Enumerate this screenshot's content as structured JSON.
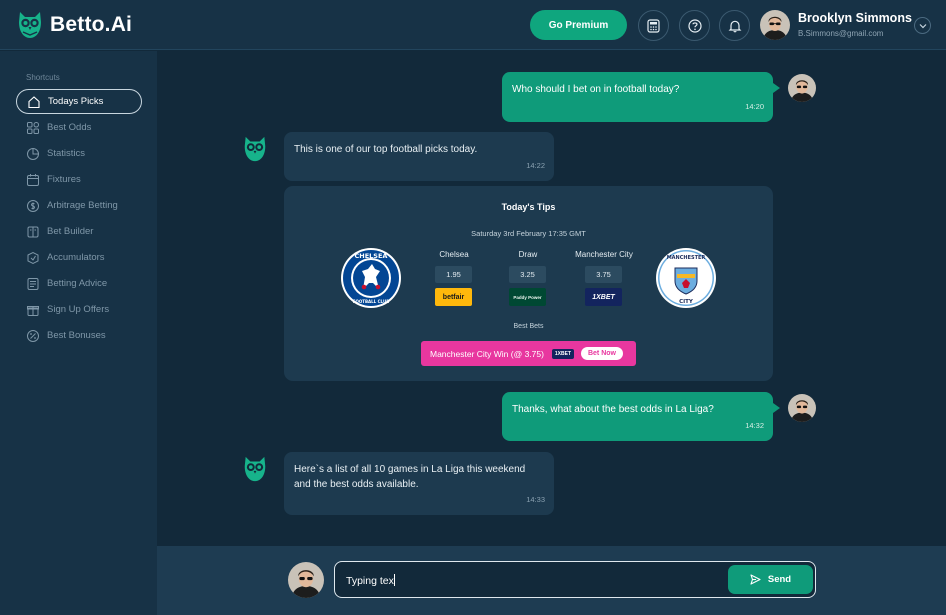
{
  "app": {
    "logo_text": "Betto.Ai"
  },
  "header": {
    "premium_label": "Go Premium",
    "user_name": "Brooklyn Simmons",
    "user_email": "B.Simmons@gmail.com",
    "icons": [
      "calculator-icon",
      "help-icon",
      "bell-icon",
      "chevron-down-icon"
    ]
  },
  "sidebar": {
    "section_label": "Shortcuts",
    "items": [
      {
        "label": "Todays Picks",
        "icon": "home-icon",
        "active": true
      },
      {
        "label": "Best Odds",
        "icon": "grid-icon",
        "active": false
      },
      {
        "label": "Statistics",
        "icon": "pie-chart-icon",
        "active": false
      },
      {
        "label": "Fixtures",
        "icon": "calendar-icon",
        "active": false
      },
      {
        "label": "Arbitrage Betting",
        "icon": "coin-icon",
        "active": false
      },
      {
        "label": "Bet Builder",
        "icon": "builder-icon",
        "active": false
      },
      {
        "label": "Accumulators",
        "icon": "accumulator-icon",
        "active": false
      },
      {
        "label": "Betting Advice",
        "icon": "advice-icon",
        "active": false
      },
      {
        "label": "Sign Up Offers",
        "icon": "gift-icon",
        "active": false
      },
      {
        "label": "Best Bonuses",
        "icon": "percent-icon",
        "active": false
      }
    ]
  },
  "messages": [
    {
      "sender": "user",
      "text": "Who should I bet on in football today?",
      "time": "14:20"
    },
    {
      "sender": "bot",
      "text": "This is one of our top football picks today.",
      "time": "14:22"
    },
    {
      "sender": "user",
      "text": "Thanks, what about the best odds in La Liga?",
      "time": "14:32"
    },
    {
      "sender": "bot",
      "line1": "Here`s a list of all 10 games in La Liga this weekend",
      "line2": "and the best odds available.",
      "time": "14:33"
    }
  ],
  "tips": {
    "title": "Today's Tips",
    "date": "Saturday 3rd February 17:35 GMT",
    "home_team": "Chelsea",
    "draw_label": "Draw",
    "away_team": "Manchester City",
    "home_odds": "1.95",
    "draw_odds": "3.25",
    "away_odds": "3.75",
    "home_bookmaker": "betfair",
    "draw_bookmaker": "Paddy Power",
    "away_bookmaker": "1XBET",
    "home_crest_text": "CHELSEA",
    "home_crest_sub": "FOOTBALL CLUB",
    "away_crest_text": "MANCHESTER",
    "away_crest_sub": "CITY",
    "best_bets_label": "Best Bets",
    "best_bet_text": "Manchester City Win (@ 3.75)",
    "best_bet_bookmaker": "1XBET",
    "bet_now_label": "Bet Now",
    "colors": {
      "betfair": "#ffb80c",
      "paddy_power": "#004833",
      "onexbet": "#1a5bc4",
      "best_bet": "#e8379f"
    }
  },
  "composer": {
    "value": "Typing tex",
    "send_label": "Send"
  },
  "colors": {
    "accent": "#0f9b7a",
    "background": "#12293a",
    "panel": "#173246"
  }
}
